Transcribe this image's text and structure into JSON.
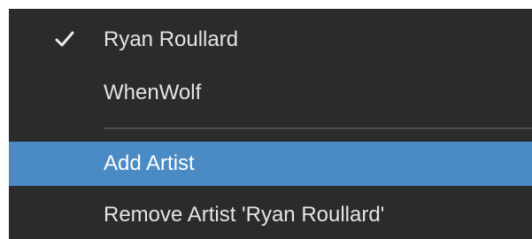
{
  "menu": {
    "items": [
      {
        "label": "Ryan Roullard",
        "checked": true,
        "icon": "checkmark-icon"
      },
      {
        "label": "WhenWolf",
        "checked": false
      }
    ],
    "actions": [
      {
        "label": "Add Artist",
        "highlighted": true
      },
      {
        "label": "Remove Artist 'Ryan Roullard'",
        "highlighted": false
      }
    ],
    "colors": {
      "background": "#2b2b2b",
      "highlight": "#4a8ac5",
      "text": "#e4e4e4"
    }
  }
}
